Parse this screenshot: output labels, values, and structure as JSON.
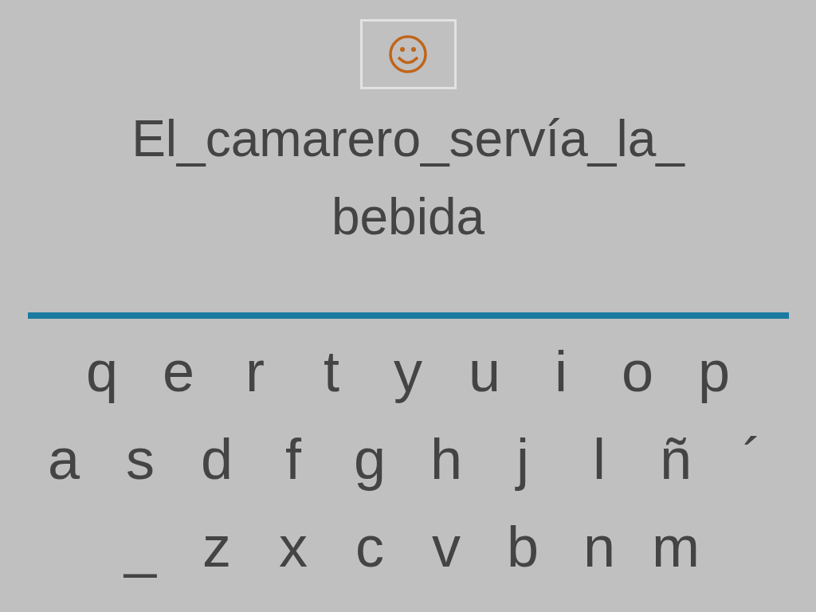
{
  "sentence_lines": [
    "El_camarero_servía_la_",
    "bebida"
  ],
  "keyboard_rows": [
    [
      "q",
      "e",
      "r",
      "t",
      "y",
      "u",
      "i",
      "o",
      "p"
    ],
    [
      "a",
      "s",
      "d",
      "f",
      "g",
      "h",
      "j",
      "l",
      "ñ",
      "´"
    ],
    [
      "_",
      "z",
      "x",
      "c",
      "v",
      "b",
      "n",
      "m"
    ]
  ]
}
